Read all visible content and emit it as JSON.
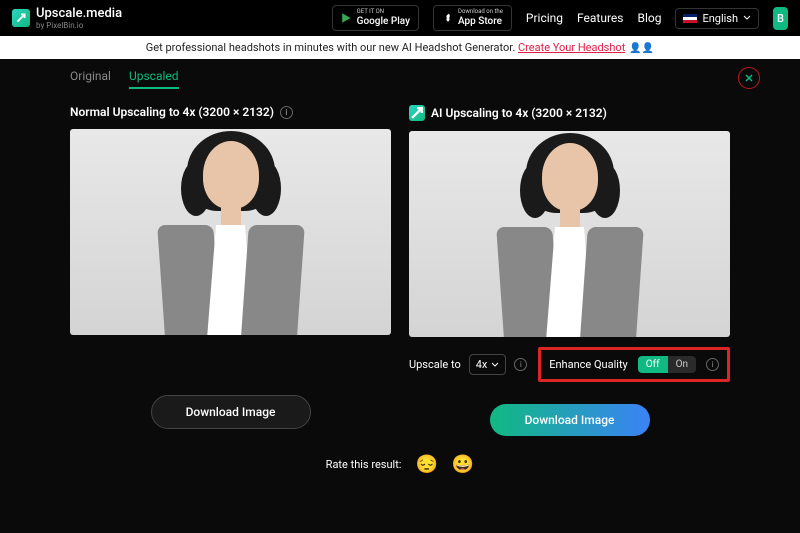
{
  "header": {
    "brand": "Upscale.media",
    "brand_sub": "by PixelBin.io",
    "gplay_tiny": "GET IT ON",
    "gplay_big": "Google Play",
    "appstore_tiny": "Download on the",
    "appstore_big": "App Store",
    "nav_pricing": "Pricing",
    "nav_features": "Features",
    "nav_blog": "Blog",
    "lang": "English",
    "cta": "B"
  },
  "banner": {
    "text": "Get professional headshots in minutes with our new AI Headshot Generator. ",
    "link": "Create Your Headshot"
  },
  "tabs": {
    "original": "Original",
    "upscaled": "Upscaled"
  },
  "left": {
    "title": "Normal Upscaling to 4x (3200 × 2132)",
    "download": "Download Image"
  },
  "right": {
    "title": "AI Upscaling to 4x (3200 × 2132)",
    "upscale_to": "Upscale to",
    "upscale_val": "4x",
    "enhance": "Enhance Quality",
    "off": "Off",
    "on": "On",
    "download": "Download Image"
  },
  "rate": {
    "label": "Rate this result:"
  }
}
